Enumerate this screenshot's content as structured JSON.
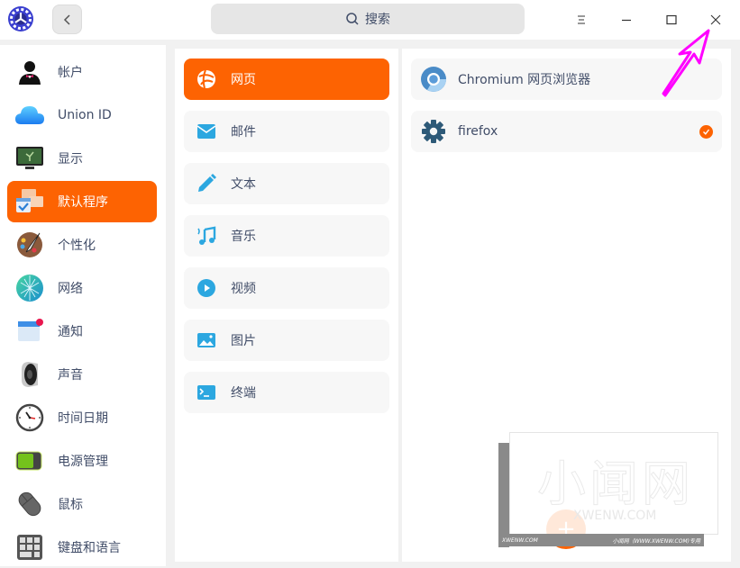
{
  "titlebar": {
    "back_label": "‹",
    "search_placeholder": "搜索",
    "icons": [
      "app-logo-icon",
      "back-icon",
      "search-icon",
      "menu-icon",
      "minimize-icon",
      "maximize-icon",
      "close-icon"
    ]
  },
  "sidebar": {
    "items": [
      {
        "label": "帐户",
        "icon": "account-icon"
      },
      {
        "label": "Union ID",
        "icon": "cloud-icon"
      },
      {
        "label": "显示",
        "icon": "display-icon"
      },
      {
        "label": "默认程序",
        "icon": "default-apps-icon",
        "active": true
      },
      {
        "label": "个性化",
        "icon": "personalization-icon"
      },
      {
        "label": "网络",
        "icon": "network-icon"
      },
      {
        "label": "通知",
        "icon": "notification-icon"
      },
      {
        "label": "声音",
        "icon": "sound-icon"
      },
      {
        "label": "时间日期",
        "icon": "clock-icon"
      },
      {
        "label": "电源管理",
        "icon": "battery-icon"
      },
      {
        "label": "鼠标",
        "icon": "mouse-icon"
      },
      {
        "label": "键盘和语言",
        "icon": "keyboard-icon"
      }
    ]
  },
  "categories": {
    "items": [
      {
        "label": "网页",
        "icon": "web-icon",
        "active": true
      },
      {
        "label": "邮件",
        "icon": "mail-icon"
      },
      {
        "label": "文本",
        "icon": "pencil-icon"
      },
      {
        "label": "音乐",
        "icon": "music-icon"
      },
      {
        "label": "视频",
        "icon": "play-icon"
      },
      {
        "label": "图片",
        "icon": "image-icon"
      },
      {
        "label": "终端",
        "icon": "terminal-icon"
      }
    ]
  },
  "apps": {
    "items": [
      {
        "label": "Chromium 网页浏览器",
        "icon": "chromium-icon",
        "selected": false
      },
      {
        "label": "firefox",
        "icon": "gear-icon",
        "selected": true
      }
    ],
    "add_label": "+"
  },
  "watermark": {
    "big_text": "小闻网",
    "url": "XWENW.COM",
    "bottom_left": "XWENW.COM",
    "bottom_right": "小闻网（WWW.XWENW.COM)专用",
    "side": "WWW.XWENW.COM"
  },
  "colors": {
    "accent": "#fd6302",
    "icon_blue": "#2ca7e0",
    "annotation": "#ff00ff"
  }
}
